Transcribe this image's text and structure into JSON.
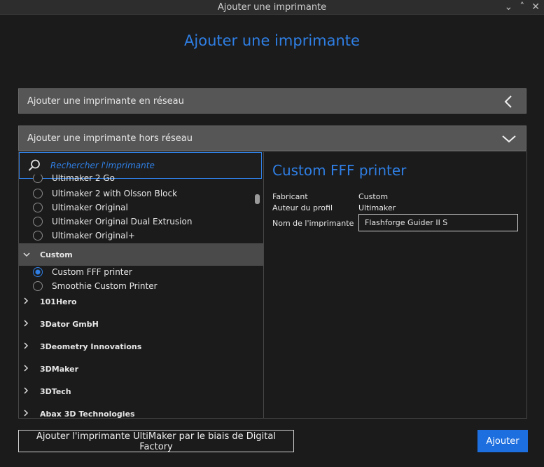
{
  "window": {
    "title": "Ajouter une imprimante",
    "controls": [
      "⌄",
      "˄",
      "✕"
    ]
  },
  "dialog": {
    "title": "Ajouter une imprimante"
  },
  "sections": {
    "network": "Ajouter une imprimante en réseau",
    "local": "Ajouter une imprimante hors réseau"
  },
  "search": {
    "placeholder": "Rechercher l'imprimante"
  },
  "list": {
    "partial_item": "Ultimaker 2 Go",
    "items": [
      "Ultimaker 2 with Olsson Block",
      "Ultimaker Original",
      "Ultimaker Original Dual Extrusion",
      "Ultimaker Original+"
    ],
    "open_group": "Custom",
    "custom_items": [
      "Custom FFF printer",
      "Smoothie Custom Printer"
    ],
    "groups": [
      "101Hero",
      "3Dator GmbH",
      "3Deometry Innovations",
      "3DMaker",
      "3DTech",
      "Abax 3D Technologies"
    ]
  },
  "details": {
    "printer_name": "Custom FFF printer",
    "manufacturer_label": "Fabricant",
    "manufacturer_value": "Custom",
    "author_label": "Auteur du profil",
    "author_value": "Ultimaker",
    "name_label": "Nom de l'imprimante",
    "name_value": "Flashforge Guider II S"
  },
  "buttons": {
    "digital_factory": "Ajouter l'imprimante UltiMaker par le biais de Digital Factory",
    "add": "Ajouter"
  },
  "colors": {
    "accent": "#2f7fe5",
    "background": "#1b1b1b",
    "header_bar": "#565656"
  }
}
